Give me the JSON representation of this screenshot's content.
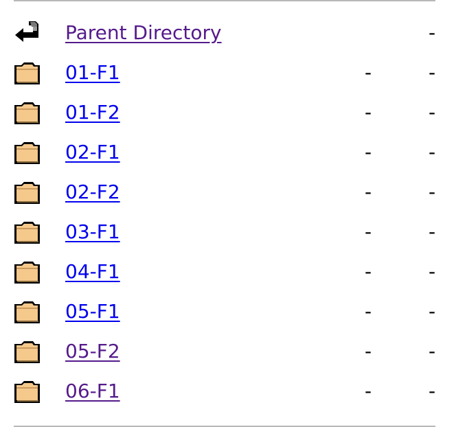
{
  "parent": {
    "label": "Parent Directory",
    "modified": "",
    "size": "-",
    "icon": "back-arrow-icon"
  },
  "entries": [
    {
      "label": "01-F1",
      "modified": "-",
      "size": "-",
      "icon": "folder-icon"
    },
    {
      "label": "01-F2",
      "modified": "-",
      "size": "-",
      "icon": "folder-icon"
    },
    {
      "label": "02-F1",
      "modified": "-",
      "size": "-",
      "icon": "folder-icon"
    },
    {
      "label": "02-F2",
      "modified": "-",
      "size": "-",
      "icon": "folder-icon"
    },
    {
      "label": "03-F1",
      "modified": "-",
      "size": "-",
      "icon": "folder-icon"
    },
    {
      "label": "04-F1",
      "modified": "-",
      "size": "-",
      "icon": "folder-icon"
    },
    {
      "label": "05-F1",
      "modified": "-",
      "size": "-",
      "icon": "folder-icon"
    },
    {
      "label": "05-F2",
      "modified": "-",
      "size": "-",
      "icon": "folder-icon"
    },
    {
      "label": "06-F1",
      "modified": "-",
      "size": "-",
      "icon": "folder-icon"
    }
  ],
  "colors": {
    "link": "#0000ee",
    "visited_link": "#551a8b",
    "folder_fill": "#f5c88c",
    "rule": "#b8b8b8"
  }
}
